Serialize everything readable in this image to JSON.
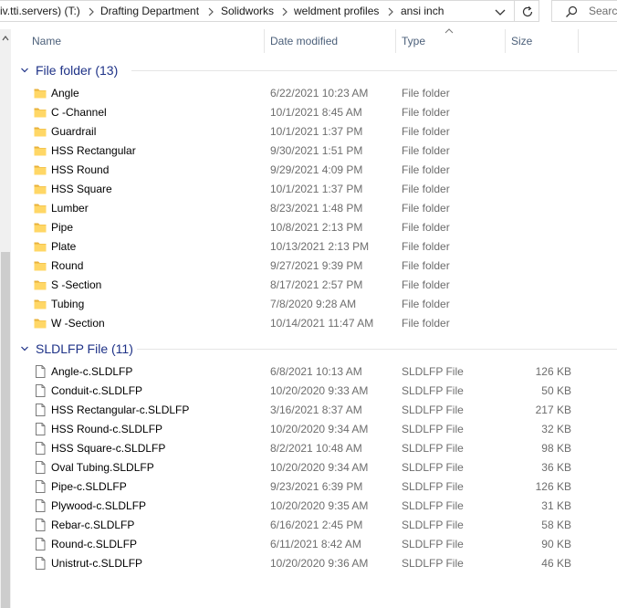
{
  "address_bar": {
    "segments": [
      "iv.tti.servers) (T:)",
      "Drafting Department",
      "Solidworks",
      "weldment profiles",
      "ansi inch"
    ]
  },
  "search": {
    "placeholder": "Search"
  },
  "columns": {
    "name": "Name",
    "date": "Date modified",
    "type": "Type",
    "size": "Size"
  },
  "groups": [
    {
      "title": "File folder (13)",
      "icon": "folder-icon",
      "items": [
        {
          "name": "Angle",
          "date": "6/22/2021 10:23 AM",
          "type": "File folder",
          "size": ""
        },
        {
          "name": "C -Channel",
          "date": "10/1/2021 8:45 AM",
          "type": "File folder",
          "size": ""
        },
        {
          "name": "Guardrail",
          "date": "10/1/2021 1:37 PM",
          "type": "File folder",
          "size": ""
        },
        {
          "name": "HSS Rectangular",
          "date": "9/30/2021 1:51 PM",
          "type": "File folder",
          "size": ""
        },
        {
          "name": "HSS Round",
          "date": "9/29/2021 4:09 PM",
          "type": "File folder",
          "size": ""
        },
        {
          "name": "HSS Square",
          "date": "10/1/2021 1:37 PM",
          "type": "File folder",
          "size": ""
        },
        {
          "name": "Lumber",
          "date": "8/23/2021 1:48 PM",
          "type": "File folder",
          "size": ""
        },
        {
          "name": "Pipe",
          "date": "10/8/2021 2:13 PM",
          "type": "File folder",
          "size": ""
        },
        {
          "name": "Plate",
          "date": "10/13/2021 2:13 PM",
          "type": "File folder",
          "size": ""
        },
        {
          "name": "Round",
          "date": "9/27/2021 9:39 PM",
          "type": "File folder",
          "size": ""
        },
        {
          "name": "S -Section",
          "date": "8/17/2021 2:57 PM",
          "type": "File folder",
          "size": ""
        },
        {
          "name": "Tubing",
          "date": "7/8/2020 9:28 AM",
          "type": "File folder",
          "size": ""
        },
        {
          "name": "W -Section",
          "date": "10/14/2021 11:47 AM",
          "type": "File folder",
          "size": ""
        }
      ]
    },
    {
      "title": "SLDLFP File (11)",
      "icon": "file-icon",
      "items": [
        {
          "name": "Angle-c.SLDLFP",
          "date": "6/8/2021 10:13 AM",
          "type": "SLDLFP File",
          "size": "126 KB"
        },
        {
          "name": "Conduit-c.SLDLFP",
          "date": "10/20/2020 9:33 AM",
          "type": "SLDLFP File",
          "size": "50 KB"
        },
        {
          "name": "HSS Rectangular-c.SLDLFP",
          "date": "3/16/2021 8:37 AM",
          "type": "SLDLFP File",
          "size": "217 KB"
        },
        {
          "name": "HSS Round-c.SLDLFP",
          "date": "10/20/2020 9:34 AM",
          "type": "SLDLFP File",
          "size": "32 KB"
        },
        {
          "name": "HSS Square-c.SLDLFP",
          "date": "8/2/2021 10:48 AM",
          "type": "SLDLFP File",
          "size": "98 KB"
        },
        {
          "name": "Oval Tubing.SLDLFP",
          "date": "10/20/2020 9:34 AM",
          "type": "SLDLFP File",
          "size": "36 KB"
        },
        {
          "name": "Pipe-c.SLDLFP",
          "date": "9/23/2021 6:39 PM",
          "type": "SLDLFP File",
          "size": "126 KB"
        },
        {
          "name": "Plywood-c.SLDLFP",
          "date": "10/20/2020 9:35 AM",
          "type": "SLDLFP File",
          "size": "31 KB"
        },
        {
          "name": "Rebar-c.SLDLFP",
          "date": "6/16/2021 2:45 PM",
          "type": "SLDLFP File",
          "size": "58 KB"
        },
        {
          "name": "Round-c.SLDLFP",
          "date": "6/11/2021 8:42 AM",
          "type": "SLDLFP File",
          "size": "90 KB"
        },
        {
          "name": "Unistrut-c.SLDLFP",
          "date": "10/20/2020 9:36 AM",
          "type": "SLDLFP File",
          "size": "46 KB"
        }
      ]
    }
  ],
  "colors": {
    "group_title": "#1e3287",
    "header_text": "#4c607a",
    "secondary_text": "#6d6d6d",
    "folder_fill": "#ffd766",
    "folder_back": "#e8b23a"
  }
}
